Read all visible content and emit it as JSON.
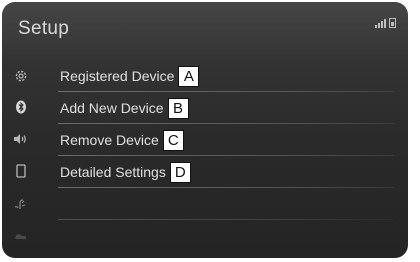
{
  "header": {
    "title": "Setup"
  },
  "status": {
    "signal_icon": "signal-bars-icon",
    "battery_icon": "battery-icon"
  },
  "sidebar": {
    "items": [
      {
        "icon": "gear-icon"
      },
      {
        "icon": "bluetooth-icon",
        "selected": true
      },
      {
        "icon": "speaker-icon"
      },
      {
        "icon": "phone-icon"
      },
      {
        "icon": "voice-icon"
      },
      {
        "icon": "vehicle-icon"
      }
    ]
  },
  "menu": {
    "items": [
      {
        "label": "Registered Device",
        "callout": "A"
      },
      {
        "label": "Add New Device",
        "callout": "B"
      },
      {
        "label": "Remove Device",
        "callout": "C"
      },
      {
        "label": "Detailed Settings",
        "callout": "D"
      }
    ]
  },
  "colors": {
    "background": "#2e2e2e",
    "text": "#e0e0e0",
    "icon": "#b8b8b8"
  }
}
